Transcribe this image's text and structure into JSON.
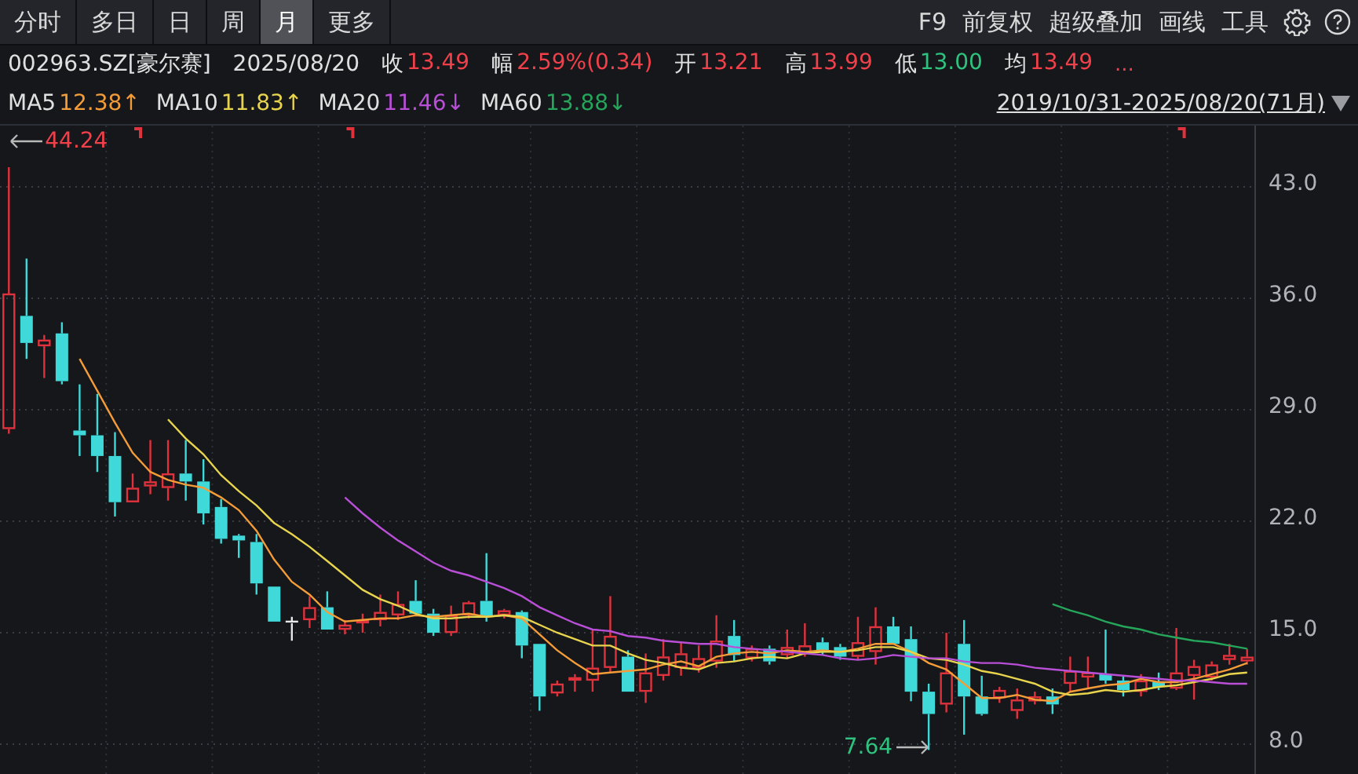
{
  "toolbar": {
    "tabs": [
      {
        "label": "分时",
        "selected": false
      },
      {
        "label": "多日",
        "selected": false
      },
      {
        "label": "日",
        "selected": false
      },
      {
        "label": "周",
        "selected": false
      },
      {
        "label": "月",
        "selected": true
      },
      {
        "label": "更多",
        "selected": false
      }
    ],
    "tools": [
      "F9",
      "前复权",
      "超级叠加",
      "画线",
      "工具"
    ]
  },
  "quote": {
    "symbol": "002963.SZ[豪尔赛]",
    "date": "2025/08/20",
    "fields": [
      {
        "label": "收",
        "value": "13.49",
        "color": "#f0414b"
      },
      {
        "label": "幅",
        "value": "2.59%(0.34)",
        "color": "#f0414b"
      },
      {
        "label": "开",
        "value": "13.21",
        "color": "#f0414b"
      },
      {
        "label": "高",
        "value": "13.99",
        "color": "#f0414b"
      },
      {
        "label": "低",
        "value": "13.00",
        "color": "#2ec27e"
      },
      {
        "label": "均",
        "value": "13.49",
        "color": "#f0414b"
      }
    ],
    "more": "..."
  },
  "moving_averages": [
    {
      "value": "12.38↑"
    },
    {
      "value": "11.83↑"
    },
    {
      "value": "11.46↓"
    },
    {
      "value": "13.88↓"
    }
  ],
  "range": {
    "label": "2019/10/31-2025/08/20(71月)"
  },
  "chart": {
    "high_marker": "44.24",
    "low_marker": "7.64",
    "chart_data": {
      "type": "candlestick",
      "ylim": [
        6.13,
        46.85
      ],
      "grid": true,
      "series": [
        {
          "name": "MA5",
          "color": "#f39c38",
          "type": "line",
          "values": [
            null,
            null,
            null,
            null,
            32.2,
            30.2,
            28.2,
            26.3,
            25.1,
            24.6,
            24.3,
            24.1,
            23.5,
            22.7,
            21.4,
            19.6,
            18.2,
            17.4,
            16.3,
            15.7,
            15.8,
            15.9,
            15.9,
            16.1,
            16.0,
            16.1,
            16.2,
            16.0,
            16.1,
            15.9,
            14.9,
            13.9,
            13.1,
            12.4,
            12.5,
            12.6,
            12.7,
            13.0,
            13.2,
            12.9,
            13.5,
            13.7,
            13.8,
            13.7,
            13.9,
            13.8,
            13.9,
            13.8,
            14.0,
            14.3,
            14.3,
            13.8,
            13.1,
            12.7,
            11.8,
            10.9,
            10.9,
            11.1,
            10.8,
            10.7,
            11.3,
            11.5,
            11.7,
            11.8,
            12.1,
            11.9,
            11.9,
            12.1,
            12.4,
            12.7,
            13.1
          ]
        },
        {
          "name": "MA10",
          "color": "#e8d44d",
          "type": "line",
          "values": [
            null,
            null,
            null,
            null,
            null,
            null,
            null,
            null,
            null,
            28.4,
            27.2,
            26.2,
            24.9,
            23.9,
            23.0,
            21.9,
            21.2,
            20.4,
            19.5,
            18.6,
            17.7,
            17.1,
            16.7,
            16.2,
            15.9,
            15.9,
            16.0,
            16.0,
            16.1,
            16.0,
            15.5,
            15.0,
            14.6,
            14.2,
            14.2,
            13.7,
            13.3,
            13.1,
            12.8,
            12.7,
            13.1,
            13.2,
            13.4,
            13.5,
            13.4,
            13.7,
            13.8,
            13.8,
            13.9,
            14.1,
            14.1,
            13.8,
            13.4,
            13.3,
            13.0,
            12.6,
            12.4,
            12.1,
            11.8,
            11.3,
            11.1,
            11.2,
            11.4,
            11.3,
            11.4,
            11.6,
            11.7,
            11.9,
            12.1,
            12.4,
            12.5
          ]
        },
        {
          "name": "MA20",
          "color": "#b84fd6",
          "type": "line",
          "values": [
            null,
            null,
            null,
            null,
            null,
            null,
            null,
            null,
            null,
            null,
            null,
            null,
            null,
            null,
            null,
            null,
            null,
            null,
            null,
            23.5,
            22.5,
            21.6,
            20.8,
            20.1,
            19.4,
            18.9,
            18.6,
            18.2,
            17.8,
            17.3,
            16.6,
            16.1,
            15.6,
            15.2,
            15.1,
            14.8,
            14.7,
            14.5,
            14.4,
            14.3,
            14.3,
            14.1,
            14.0,
            13.9,
            13.8,
            13.7,
            13.6,
            13.4,
            13.3,
            13.4,
            13.6,
            13.5,
            13.4,
            13.4,
            13.2,
            13.1,
            13.1,
            13.0,
            12.8,
            12.7,
            12.6,
            12.5,
            12.4,
            12.3,
            12.2,
            12.1,
            12.0,
            12.0,
            11.9,
            11.8,
            11.8
          ]
        },
        {
          "name": "MA60",
          "color": "#26a65b",
          "type": "line",
          "values": [
            null,
            null,
            null,
            null,
            null,
            null,
            null,
            null,
            null,
            null,
            null,
            null,
            null,
            null,
            null,
            null,
            null,
            null,
            null,
            null,
            null,
            null,
            null,
            null,
            null,
            null,
            null,
            null,
            null,
            null,
            null,
            null,
            null,
            null,
            null,
            null,
            null,
            null,
            null,
            null,
            null,
            null,
            null,
            null,
            null,
            null,
            null,
            null,
            null,
            null,
            null,
            null,
            null,
            null,
            null,
            null,
            null,
            null,
            null,
            16.8,
            16.4,
            16.1,
            15.7,
            15.4,
            15.2,
            14.9,
            14.7,
            14.5,
            14.4,
            14.2,
            14.0
          ]
        }
      ],
      "yticks": [
        {
          "value": 43,
          "label": "43.0"
        },
        {
          "value": 36,
          "label": "36.0"
        },
        {
          "value": 29,
          "label": "29.0"
        },
        {
          "value": 22,
          "label": "22.0"
        },
        {
          "value": 15,
          "label": "15.0"
        },
        {
          "value": 8,
          "label": "8.0"
        }
      ],
      "ohlc": [
        [
          27.8,
          44.24,
          27.5,
          36.3
        ],
        [
          34.9,
          38.5,
          32.2,
          33.2
        ],
        [
          33.0,
          33.7,
          31.0,
          33.4
        ],
        [
          33.8,
          34.5,
          30.6,
          30.8
        ],
        [
          27.7,
          30.6,
          26.1,
          27.4
        ],
        [
          27.4,
          30.0,
          25.1,
          26.1
        ],
        [
          26.1,
          27.6,
          22.3,
          23.2
        ],
        [
          23.2,
          25.0,
          23.2,
          24.1
        ],
        [
          24.2,
          27.1,
          23.7,
          24.5
        ],
        [
          24.1,
          27.1,
          23.3,
          25.0
        ],
        [
          25.0,
          27.1,
          23.3,
          24.5
        ],
        [
          24.5,
          25.9,
          21.8,
          22.5
        ],
        [
          22.9,
          23.4,
          20.6,
          20.9
        ],
        [
          21.1,
          21.2,
          19.7,
          20.8
        ],
        [
          20.7,
          21.2,
          17.4,
          18.1
        ],
        [
          17.9,
          17.9,
          15.7,
          15.7
        ],
        [
          15.7,
          16.0,
          14.5,
          15.7
        ],
        [
          15.8,
          17.3,
          15.3,
          16.6
        ],
        [
          16.6,
          17.6,
          15.2,
          15.2
        ],
        [
          15.2,
          15.8,
          14.9,
          15.5
        ],
        [
          15.6,
          16.2,
          15.0,
          15.8
        ],
        [
          15.8,
          17.4,
          15.4,
          16.3
        ],
        [
          16.1,
          17.6,
          15.8,
          16.8
        ],
        [
          17.0,
          18.3,
          16.2,
          16.2
        ],
        [
          16.2,
          16.5,
          14.8,
          15.0
        ],
        [
          15.0,
          16.7,
          14.8,
          16.1
        ],
        [
          16.1,
          17.0,
          15.9,
          16.9
        ],
        [
          17.0,
          20.0,
          15.7,
          16.0
        ],
        [
          16.1,
          16.5,
          15.9,
          16.4
        ],
        [
          16.3,
          16.4,
          13.4,
          14.2
        ],
        [
          14.3,
          14.3,
          10.1,
          11.0
        ],
        [
          11.2,
          12.0,
          11.0,
          11.8
        ],
        [
          12.0,
          12.4,
          11.3,
          12.2
        ],
        [
          12.0,
          15.2,
          11.3,
          12.8
        ],
        [
          12.8,
          17.3,
          12.5,
          14.8
        ],
        [
          13.5,
          13.9,
          11.3,
          11.3
        ],
        [
          11.3,
          13.7,
          10.6,
          12.5
        ],
        [
          12.3,
          14.6,
          12.0,
          13.5
        ],
        [
          12.8,
          14.4,
          12.3,
          13.7
        ],
        [
          12.8,
          14.2,
          12.5,
          13.4
        ],
        [
          13.2,
          16.1,
          12.8,
          14.5
        ],
        [
          14.8,
          15.8,
          13.2,
          13.6
        ],
        [
          13.4,
          14.2,
          13.2,
          14.0
        ],
        [
          14.0,
          14.2,
          13.0,
          13.2
        ],
        [
          13.6,
          15.2,
          13.4,
          14.1
        ],
        [
          13.7,
          15.6,
          13.5,
          14.2
        ],
        [
          14.4,
          14.7,
          13.6,
          13.8
        ],
        [
          14.1,
          14.3,
          13.3,
          13.5
        ],
        [
          13.5,
          16.0,
          13.3,
          14.4
        ],
        [
          13.8,
          16.6,
          13.0,
          15.4
        ],
        [
          15.4,
          16.0,
          14.3,
          14.3
        ],
        [
          14.6,
          15.4,
          10.7,
          11.3
        ],
        [
          11.3,
          11.8,
          7.64,
          9.9
        ],
        [
          10.5,
          15.0,
          10.0,
          12.5
        ],
        [
          14.3,
          15.8,
          8.6,
          11.0
        ],
        [
          11.0,
          12.3,
          9.8,
          9.9
        ],
        [
          10.9,
          11.6,
          10.6,
          11.4
        ],
        [
          10.1,
          11.5,
          9.6,
          10.8
        ],
        [
          10.7,
          11.3,
          10.5,
          11.0
        ],
        [
          11.0,
          11.5,
          9.9,
          10.5
        ],
        [
          11.8,
          13.5,
          11.3,
          12.6
        ],
        [
          12.2,
          13.5,
          11.5,
          12.5
        ],
        [
          12.4,
          15.2,
          11.8,
          12.0
        ],
        [
          12.0,
          12.3,
          11.0,
          11.4
        ],
        [
          11.3,
          12.4,
          11.0,
          12.0
        ],
        [
          11.9,
          12.5,
          11.4,
          11.6
        ],
        [
          11.5,
          15.3,
          11.4,
          12.5
        ],
        [
          12.3,
          13.3,
          10.8,
          12.9
        ],
        [
          12.2,
          13.2,
          12.0,
          13.0
        ],
        [
          13.3,
          14.3,
          13.0,
          13.6
        ],
        [
          13.21,
          13.99,
          13.0,
          13.49
        ]
      ]
    }
  }
}
